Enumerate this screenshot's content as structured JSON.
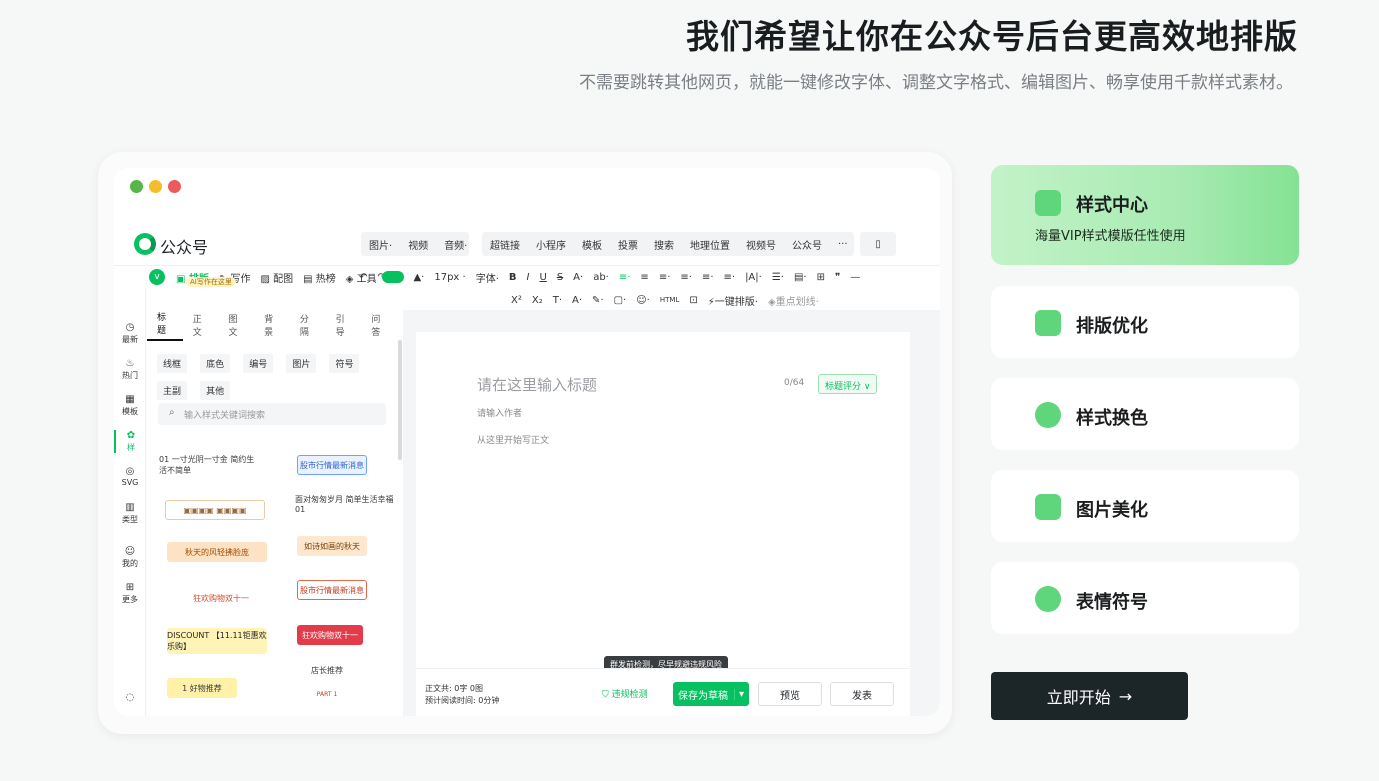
{
  "hero": {
    "title": "我们希望让你在公众号后台更高效地排版",
    "subtitle": "不需要跳转其他网页，就能一键修改字体、调整文字格式、编辑图片、畅享使用千款样式素材。"
  },
  "window": {
    "dots": [
      "#57b54a",
      "#f6bd2b",
      "#ec5b5b"
    ]
  },
  "app": {
    "logo_text": "公众号",
    "menu_a": [
      "图片·",
      "视频",
      "音频·"
    ],
    "menu_b": [
      "超链接",
      "小程序",
      "模板",
      "投票",
      "搜索",
      "地理位置",
      "视频号",
      "公众号",
      "···"
    ],
    "toolbar_1": [
      "↶",
      "↷",
      "◇",
      "▲·",
      "17px ·",
      "字体·",
      "B",
      "I",
      "U",
      "S",
      "A·",
      "ab·",
      "≡·",
      "≡",
      "≡·",
      "≡·",
      "≡·",
      "≡·",
      "|A|·",
      "☰·",
      "▤·",
      "⊞",
      "❞",
      "—",
      "○"
    ],
    "toolbar_2": [
      "X²",
      "X₂",
      "T·",
      "A·",
      "✎·",
      "▢·",
      "☺·",
      "HTML",
      "⊡",
      "⚡一键排版·",
      "◈重点划线·"
    ],
    "ai_badge": "AI写作在这里",
    "panel_tabs": [
      "排版",
      "写作",
      "配图",
      "热榜",
      "工具"
    ],
    "sub_tabs": [
      "标题",
      "正文",
      "图文",
      "背景",
      "分隔",
      "引导",
      "问答"
    ],
    "chips": [
      "线框",
      "底色",
      "编号",
      "图片",
      "符号",
      "主副",
      "其他"
    ],
    "search_placeholder": "输入样式关键词搜索",
    "left_nav": [
      {
        "icon": "◷",
        "label": "最新"
      },
      {
        "icon": "♨",
        "label": "热门"
      },
      {
        "icon": "▦",
        "label": "模板"
      },
      {
        "icon": "✿",
        "label": "样"
      },
      {
        "icon": "◎",
        "label": "SVG"
      },
      {
        "icon": "▥",
        "label": "类型"
      },
      {
        "icon": "☺",
        "label": "我的"
      },
      {
        "icon": "⊞",
        "label": "更多"
      },
      {
        "icon": "◌",
        "label": ""
      }
    ],
    "templates_left": [
      "01 一寸光阴一寸金 简约生活不简单",
      "▣▣▣▣ ▣▣▣▣",
      "秋天的风轻拂脸庞",
      "狂欢购物双十一",
      "DISCOUNT 【11.11钜惠欢乐购】",
      "1 好物推荐"
    ],
    "templates_right": [
      "股市行情最新消息",
      "面对匆匆岁月 简单生活幸福 01",
      "如诗如画的秋天",
      "股市行情最新消息",
      "狂欢购物双十一",
      "店长推荐",
      "PART 1"
    ],
    "editor": {
      "title_placeholder": "请在这里输入标题",
      "title_count": "0/64",
      "title_score": "标题评分",
      "author_placeholder": "请输入作者",
      "body_placeholder": "从这里开始写正文"
    },
    "footer": {
      "word_count_label": "正文共:",
      "word_count_value": "0字 0图",
      "read_time_label": "预计阅读时间:",
      "read_time_value": "0分钟",
      "tooltip": "群发前检测，尽早规避违规风险",
      "check_label": "违规检测",
      "save_label": "保存为草稿",
      "preview_label": "预览",
      "publish_label": "发表"
    }
  },
  "features": [
    {
      "title": "样式中心",
      "desc": "海量VIP样式模版任性使用",
      "active": true
    },
    {
      "title": "排版优化",
      "desc": "",
      "active": false
    },
    {
      "title": "样式换色",
      "desc": "",
      "active": false
    },
    {
      "title": "图片美化",
      "desc": "",
      "active": false
    },
    {
      "title": "表情符号",
      "desc": "",
      "active": false
    }
  ],
  "cta": {
    "label": "立即开始",
    "arrow": "→"
  },
  "colors": {
    "brand_green": "#07c160",
    "cta_bg": "#1c2629"
  }
}
